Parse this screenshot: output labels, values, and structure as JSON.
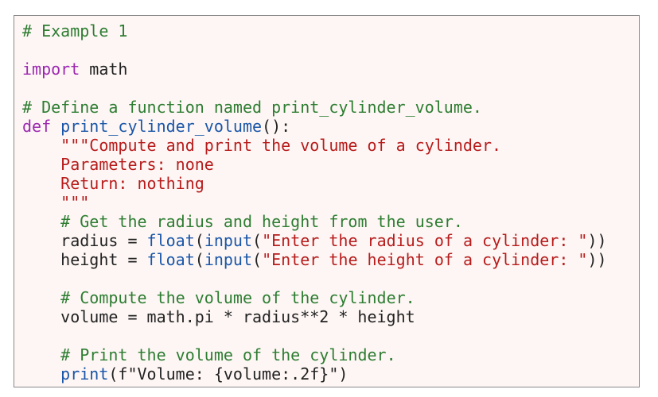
{
  "colors": {
    "comment": "#2e7d32",
    "keyword": "#9c27b0",
    "string": "#b71c1c",
    "function": "#1a56a8",
    "text": "#222222",
    "background": "#fdf6f4",
    "border": "#8a8a8a"
  },
  "code": {
    "l01": "# Example 1",
    "l03_kw": "import",
    "l03_rest": " math",
    "l05": "# Define a function named print_cylinder_volume.",
    "l06_kw": "def",
    "l06_sp": " ",
    "l06_fn": "print_cylinder_volume",
    "l06_rest": "():",
    "l07_indent": "    ",
    "l07_str": "\"\"\"Compute and print the volume of a cylinder.",
    "l08_str": "    Parameters: none",
    "l09_str": "    Return: nothing",
    "l10_str": "    \"\"\"",
    "l11_indent": "    ",
    "l11_cm": "# Get the radius and height from the user.",
    "l12_indent": "    ",
    "l12_var": "radius = ",
    "l12_f1": "float",
    "l12_p1": "(",
    "l12_f2": "input",
    "l12_p2": "(",
    "l12_str": "\"Enter the radius of a cylinder: \"",
    "l12_end": "))",
    "l13_indent": "    ",
    "l13_var": "height = ",
    "l13_f1": "float",
    "l13_p1": "(",
    "l13_f2": "input",
    "l13_p2": "(",
    "l13_str": "\"Enter the height of a cylinder: \"",
    "l13_end": "))",
    "l15_indent": "    ",
    "l15_cm": "# Compute the volume of the cylinder.",
    "l16": "    volume = math.pi * radius**2 * height",
    "l18_indent": "    ",
    "l18_cm": "# Print the volume of the cylinder.",
    "l19_indent": "    ",
    "l19_fn": "print",
    "l19_rest": "(f\"Volume: {volume:.2f}\")"
  }
}
